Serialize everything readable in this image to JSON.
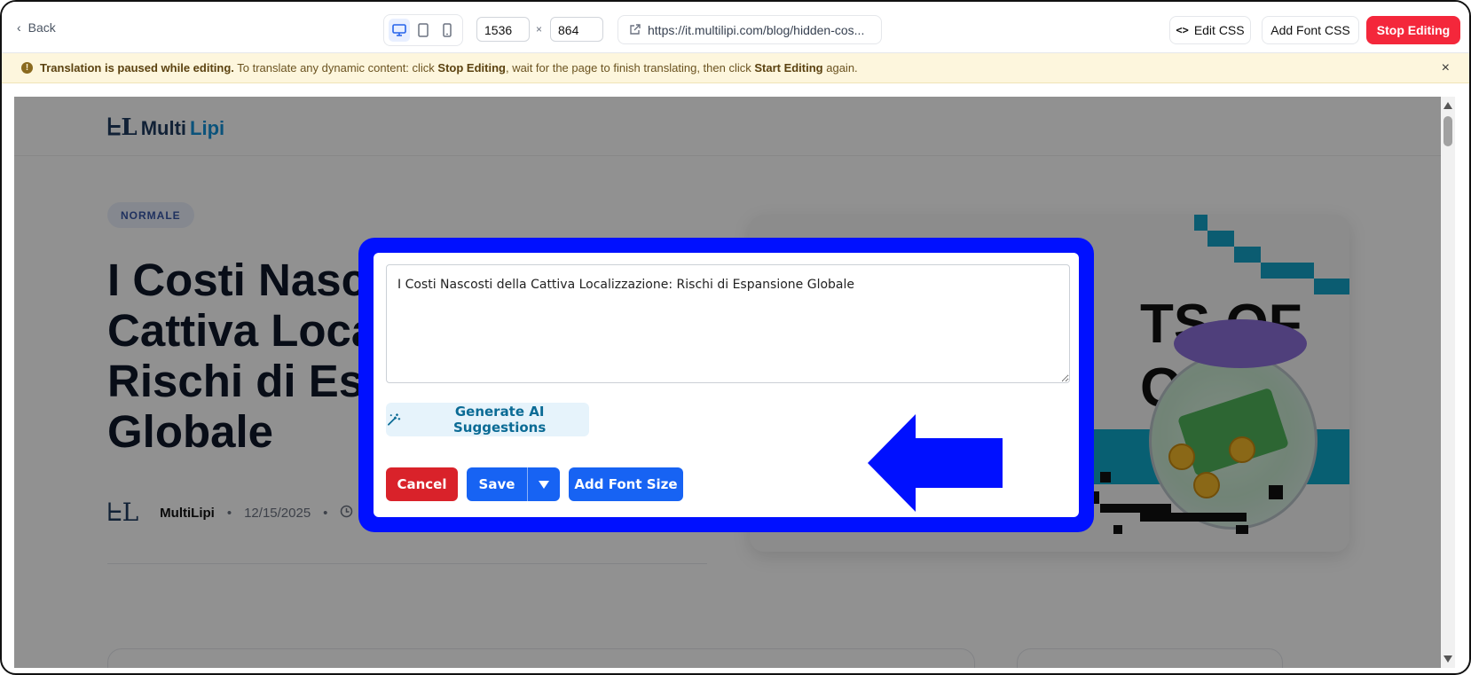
{
  "toolbar": {
    "back_label": "Back",
    "width_value": "1536",
    "height_value": "864",
    "times": "×",
    "url": "https://it.multilipi.com/blog/hidden-cos...",
    "edit_css_label": "Edit CSS",
    "add_font_css_label": "Add Font CSS",
    "stop_editing_label": "Stop Editing",
    "icons": [
      "chevron-left-icon",
      "desktop-icon",
      "tablet-icon",
      "mobile-icon",
      "external-link-icon",
      "code-icon"
    ]
  },
  "banner": {
    "bold_lead": "Translation is paused while editing.",
    "text_1": " To translate any dynamic content: click ",
    "stop_label": "Stop Editing",
    "text_2": ", wait for the page to finish translating, then click ",
    "start_label": "Start Editing",
    "text_3": " again.",
    "close": "×"
  },
  "site": {
    "logo_mark": "ᖶL",
    "logo_multi": "Multi",
    "logo_lipi": "Lipi",
    "category": "NORMALE",
    "title": "I Costi Nascosti della Cattiva Localizzazione: Rischi di Espansione Globale",
    "title_line_1": "I Costi Nasc",
    "title_line_2": "Cattiva Loca",
    "title_line_3": "Rischi di Esp",
    "title_line_4": "Globale",
    "author": "MultiLipi",
    "date": "12/15/2025",
    "hero_text_1": "TS OF",
    "hero_text_2": "ON"
  },
  "modal": {
    "text_value": "I Costi Nascosti della Cattiva Localizzazione: Rischi di Espansione Globale",
    "ai_label": "Generate AI Suggestions",
    "cancel_label": "Cancel",
    "save_label": "Save",
    "add_font_size_label": "Add Font Size"
  },
  "colors": {
    "stop_button": "#f4273b",
    "primary": "#1763f3",
    "danger": "#d9222a",
    "highlight": "#0010ff",
    "banner_bg": "#fdf6dd"
  }
}
